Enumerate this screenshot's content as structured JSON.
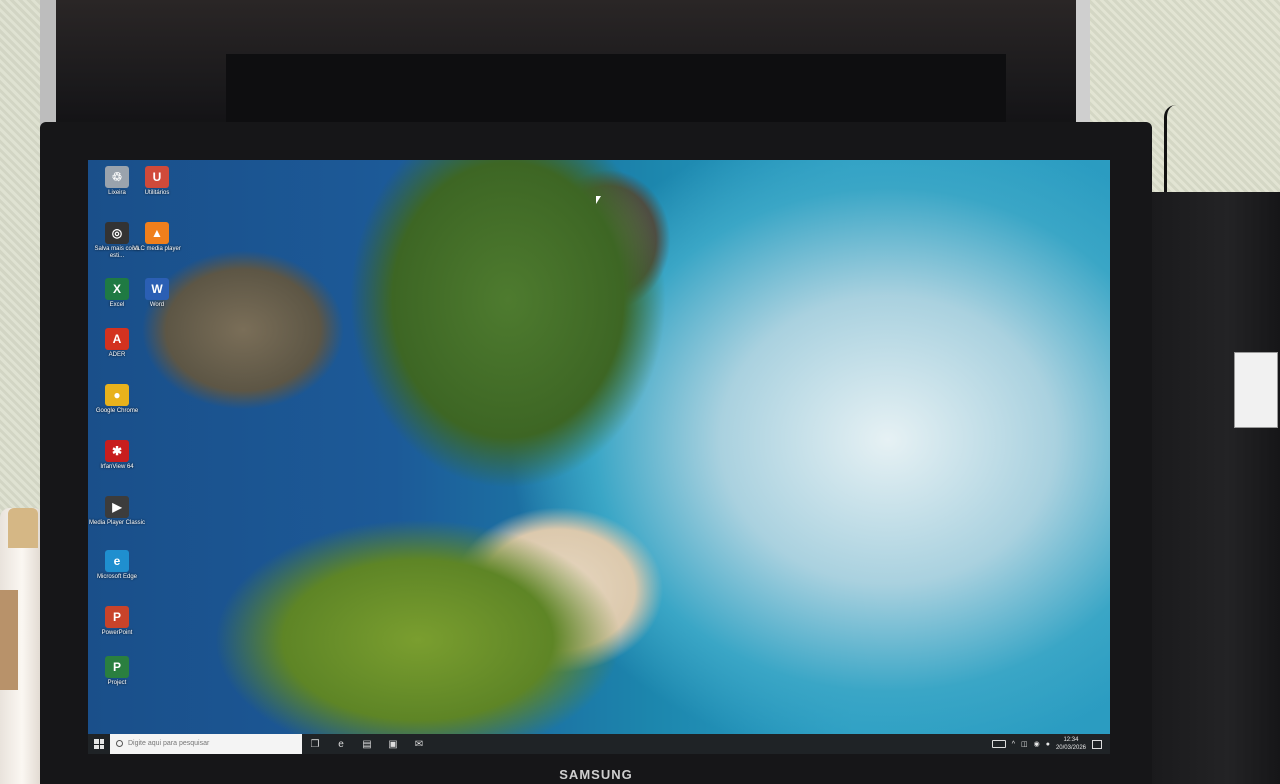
{
  "brand": "SAMSUNG",
  "desktop": {
    "icons": [
      {
        "label": "Lixeira",
        "icon": "recycle-bin-icon",
        "color": "#9aa3ad",
        "glyph": "♲"
      },
      {
        "label": "Utilitários",
        "icon": "utilities-icon",
        "color": "#d04a3a",
        "glyph": "U"
      },
      {
        "label": "Salva mais coisa esti...",
        "icon": "app-icon",
        "color": "#333333",
        "glyph": "◎"
      },
      {
        "label": "VLC media player",
        "icon": "vlc-icon",
        "color": "#f07f1c",
        "glyph": "▲"
      },
      {
        "label": "Excel",
        "icon": "excel-icon",
        "color": "#1f7a43",
        "glyph": "X"
      },
      {
        "label": "Word",
        "icon": "word-icon",
        "color": "#2b5fb4",
        "glyph": "W"
      },
      {
        "label": "ADER",
        "icon": "pdf-reader-icon",
        "color": "#d3321f",
        "glyph": "A"
      },
      {
        "label": "Google Chrome",
        "icon": "chrome-icon",
        "color": "#e8b21c",
        "glyph": "●"
      },
      {
        "label": "IrfanView 64",
        "icon": "irfanview-icon",
        "color": "#c81e1e",
        "glyph": "✱"
      },
      {
        "label": "Media Player Classic",
        "icon": "media-player-classic-icon",
        "color": "#3c3c3c",
        "glyph": "▶"
      },
      {
        "label": "Microsoft Edge",
        "icon": "edge-icon",
        "color": "#1f8fcf",
        "glyph": "e"
      },
      {
        "label": "PowerPoint",
        "icon": "powerpoint-icon",
        "color": "#c8432a",
        "glyph": "P"
      },
      {
        "label": "Project",
        "icon": "project-icon",
        "color": "#2a7f3f",
        "glyph": "P"
      }
    ]
  },
  "taskbar": {
    "search_placeholder": "Digite aqui para pesquisar",
    "pinned": [
      {
        "icon": "task-view-icon",
        "glyph": "❐"
      },
      {
        "icon": "edge-icon",
        "glyph": "e"
      },
      {
        "icon": "file-explorer-icon",
        "glyph": "▤"
      },
      {
        "icon": "store-icon",
        "glyph": "▣"
      },
      {
        "icon": "mail-icon",
        "glyph": "✉"
      }
    ],
    "time": "12:34",
    "date": "20/03/2026"
  }
}
